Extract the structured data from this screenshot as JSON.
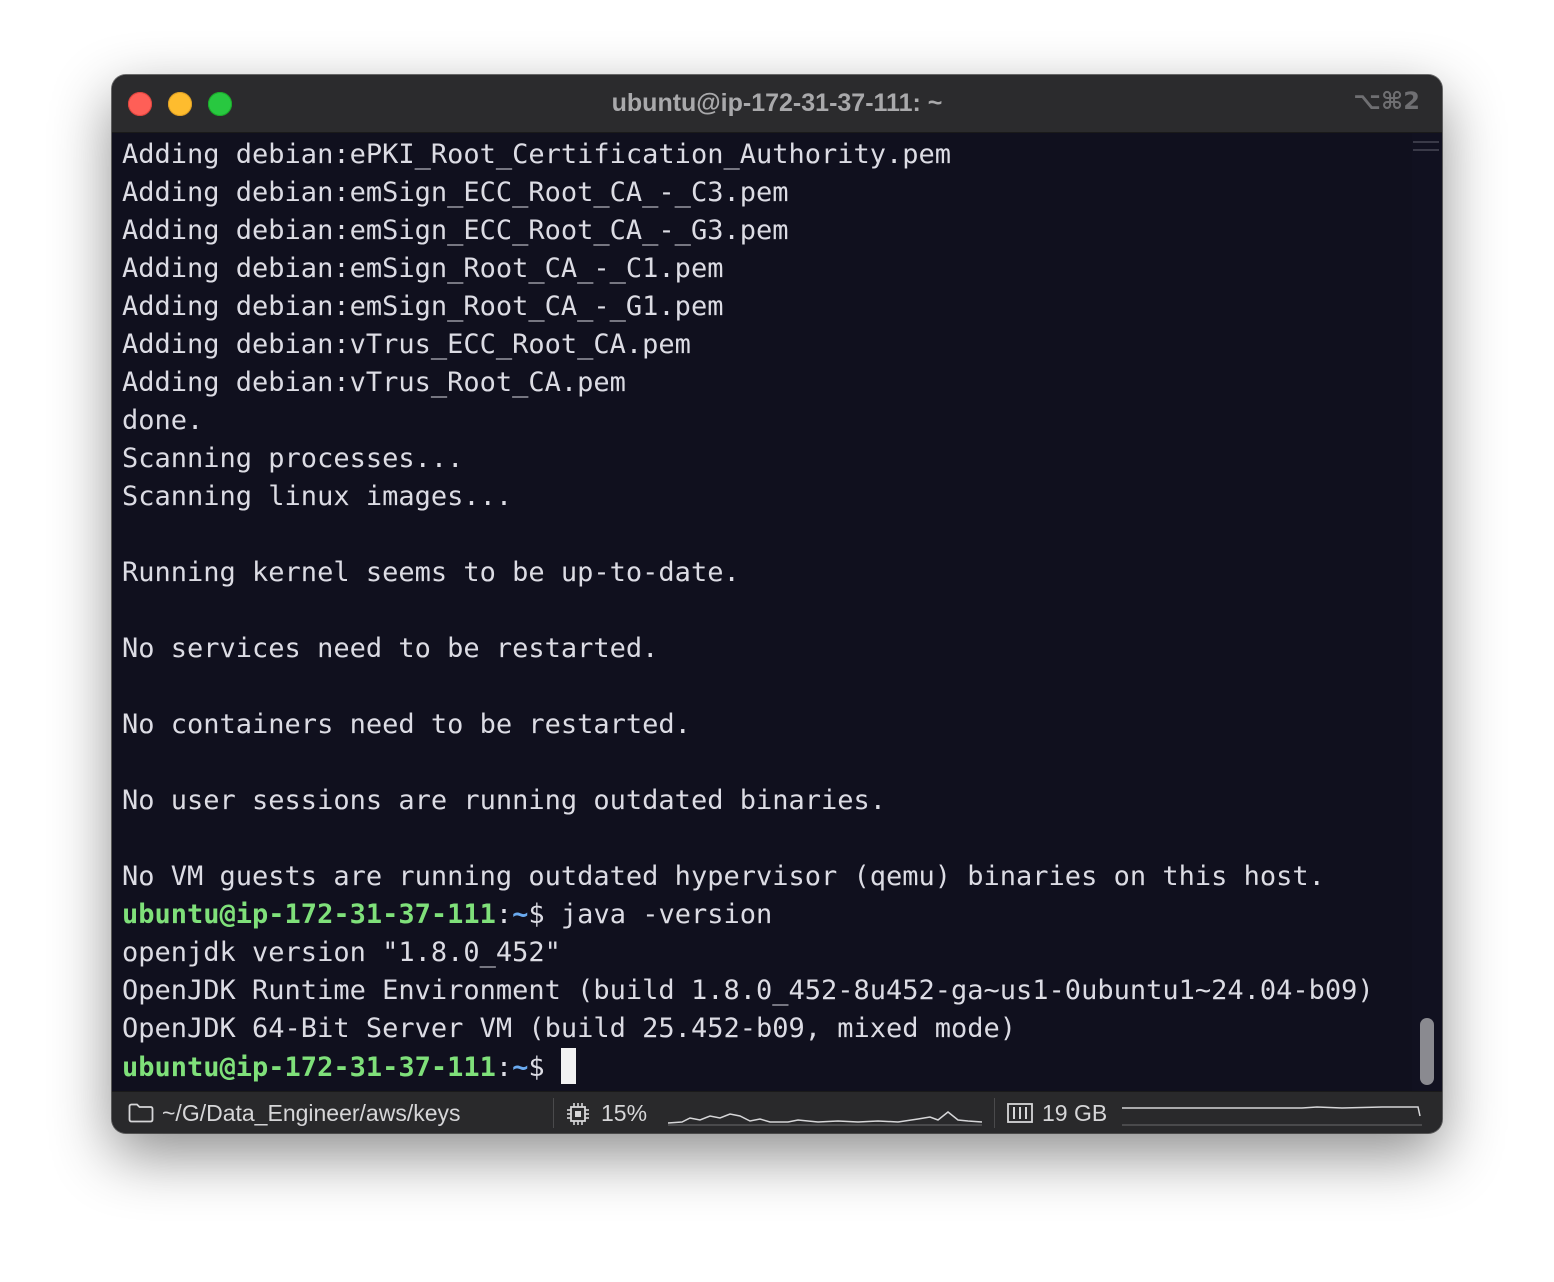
{
  "window": {
    "title": "ubuntu@ip-172-31-37-111: ~",
    "shortcut": "⌥⌘2"
  },
  "terminal": {
    "lines": [
      {
        "text": "Adding debian:ePKI_Root_Certification_Authority.pem"
      },
      {
        "text": "Adding debian:emSign_ECC_Root_CA_-_C3.pem"
      },
      {
        "text": "Adding debian:emSign_ECC_Root_CA_-_G3.pem"
      },
      {
        "text": "Adding debian:emSign_Root_CA_-_C1.pem"
      },
      {
        "text": "Adding debian:emSign_Root_CA_-_G1.pem"
      },
      {
        "text": "Adding debian:vTrus_ECC_Root_CA.pem"
      },
      {
        "text": "Adding debian:vTrus_Root_CA.pem"
      },
      {
        "text": "done."
      },
      {
        "text": "Scanning processes..."
      },
      {
        "text": "Scanning linux images..."
      },
      {
        "text": "Running kernel seems to be up-to-date."
      },
      {
        "text": "No services need to be restarted."
      },
      {
        "text": "No containers need to be restarted."
      },
      {
        "text": "No user sessions are running outdated binaries."
      },
      {
        "text": "No VM guests are running outdated hypervisor (qemu) binaries on this host."
      }
    ],
    "prompt_user": "ubuntu@ip-172-31-37-111",
    "prompt_colon": ":",
    "prompt_path": "~",
    "prompt_dollar": "$",
    "command": " java -version",
    "output": [
      {
        "text": "openjdk version \"1.8.0_452\""
      },
      {
        "text": "OpenJDK Runtime Environment (build 1.8.0_452-8u452-ga~us1-0ubuntu1~24.04-b09)"
      },
      {
        "text": "OpenJDK 64-Bit Server VM (build 25.452-b09, mixed mode)"
      }
    ]
  },
  "statusbar": {
    "path": "~/G/Data_Engineer/aws/keys",
    "cpu": "15%",
    "memory": "19 GB",
    "icons": {
      "folder": "folder-icon",
      "cpu": "cpu-icon",
      "memory": "memory-icon"
    }
  }
}
